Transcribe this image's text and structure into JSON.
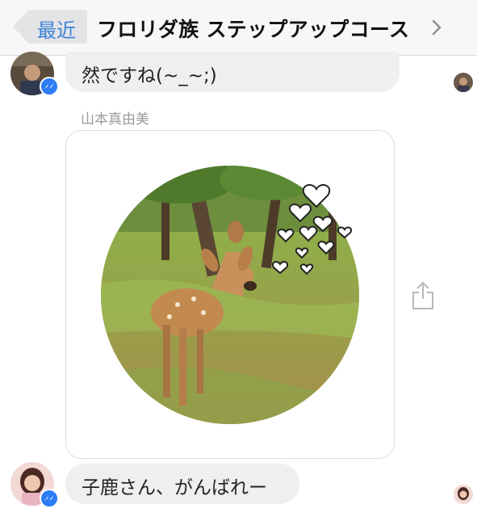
{
  "nav": {
    "back_label": "最近",
    "title": "フロリダ族 ステップアップコース"
  },
  "messages": [
    {
      "text": "然ですね(~_~;)"
    },
    {
      "sender": "山本真由美",
      "type": "sticker",
      "image_alt": "deer photo sticker with hearts"
    },
    {
      "text": "子鹿さん、がんばれー"
    }
  ],
  "colors": {
    "accent": "#3c83d6",
    "badge": "#2d7cf6",
    "bubble": "#efeff1"
  }
}
